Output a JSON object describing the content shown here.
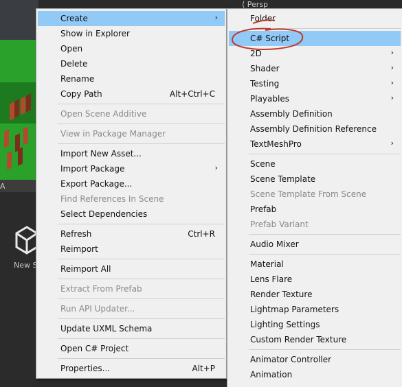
{
  "background": {
    "persp_label": "Persp",
    "toolbar_text": "A",
    "new_item_label": "New S"
  },
  "context_menu": {
    "items": [
      {
        "label": "Create",
        "shortcut": "",
        "submenu": true,
        "highlighted": true,
        "disabled": false
      },
      {
        "label": "Show in Explorer",
        "shortcut": "",
        "submenu": false,
        "disabled": false
      },
      {
        "label": "Open",
        "shortcut": "",
        "submenu": false,
        "disabled": false
      },
      {
        "label": "Delete",
        "shortcut": "",
        "submenu": false,
        "disabled": false
      },
      {
        "label": "Rename",
        "shortcut": "",
        "submenu": false,
        "disabled": false
      },
      {
        "label": "Copy Path",
        "shortcut": "Alt+Ctrl+C",
        "submenu": false,
        "disabled": false
      },
      {
        "label": "Open Scene Additive",
        "shortcut": "",
        "submenu": false,
        "disabled": true
      },
      {
        "label": "View in Package Manager",
        "shortcut": "",
        "submenu": false,
        "disabled": true
      },
      {
        "label": "Import New Asset...",
        "shortcut": "",
        "submenu": false,
        "disabled": false
      },
      {
        "label": "Import Package",
        "shortcut": "",
        "submenu": true,
        "disabled": false
      },
      {
        "label": "Export Package...",
        "shortcut": "",
        "submenu": false,
        "disabled": false
      },
      {
        "label": "Find References In Scene",
        "shortcut": "",
        "submenu": false,
        "disabled": true
      },
      {
        "label": "Select Dependencies",
        "shortcut": "",
        "submenu": false,
        "disabled": false
      },
      {
        "label": "Refresh",
        "shortcut": "Ctrl+R",
        "submenu": false,
        "disabled": false
      },
      {
        "label": "Reimport",
        "shortcut": "",
        "submenu": false,
        "disabled": false
      },
      {
        "label": "Reimport All",
        "shortcut": "",
        "submenu": false,
        "disabled": false
      },
      {
        "label": "Extract From Prefab",
        "shortcut": "",
        "submenu": false,
        "disabled": true
      },
      {
        "label": "Run API Updater...",
        "shortcut": "",
        "submenu": false,
        "disabled": true
      },
      {
        "label": "Update UXML Schema",
        "shortcut": "",
        "submenu": false,
        "disabled": false
      },
      {
        "label": "Open C# Project",
        "shortcut": "",
        "submenu": false,
        "disabled": false
      },
      {
        "label": "Properties...",
        "shortcut": "Alt+P",
        "submenu": false,
        "disabled": false
      }
    ]
  },
  "create_submenu": {
    "items": [
      {
        "label": "Folder",
        "submenu": false,
        "disabled": false
      },
      {
        "label": "C# Script",
        "submenu": false,
        "disabled": false
      },
      {
        "label": "2D",
        "submenu": true,
        "disabled": false
      },
      {
        "label": "Shader",
        "submenu": true,
        "disabled": false
      },
      {
        "label": "Testing",
        "submenu": true,
        "disabled": false
      },
      {
        "label": "Playables",
        "submenu": true,
        "disabled": false
      },
      {
        "label": "Assembly Definition",
        "submenu": false,
        "disabled": false
      },
      {
        "label": "Assembly Definition Reference",
        "submenu": false,
        "disabled": false
      },
      {
        "label": "TextMeshPro",
        "submenu": true,
        "disabled": false
      },
      {
        "label": "Scene",
        "submenu": false,
        "disabled": false
      },
      {
        "label": "Scene Template",
        "submenu": false,
        "disabled": false
      },
      {
        "label": "Scene Template From Scene",
        "submenu": false,
        "disabled": true
      },
      {
        "label": "Prefab",
        "submenu": false,
        "disabled": false
      },
      {
        "label": "Prefab Variant",
        "submenu": false,
        "disabled": true
      },
      {
        "label": "Audio Mixer",
        "submenu": false,
        "disabled": false
      },
      {
        "label": "Material",
        "submenu": false,
        "disabled": false
      },
      {
        "label": "Lens Flare",
        "submenu": false,
        "disabled": false
      },
      {
        "label": "Render Texture",
        "submenu": false,
        "disabled": false
      },
      {
        "label": "Lightmap Parameters",
        "submenu": false,
        "disabled": false
      },
      {
        "label": "Lighting Settings",
        "submenu": false,
        "disabled": false
      },
      {
        "label": "Custom Render Texture",
        "submenu": false,
        "disabled": false
      },
      {
        "label": "Animator Controller",
        "submenu": false,
        "disabled": false
      },
      {
        "label": "Animation",
        "submenu": false,
        "disabled": false
      }
    ]
  },
  "annotation": {
    "color": "#c0392b",
    "icon": "hand-drawn-circle"
  },
  "colors": {
    "menu_bg": "#f0f0f0",
    "highlight": "#91c9f7",
    "disabled_text": "#8a8a8a"
  }
}
